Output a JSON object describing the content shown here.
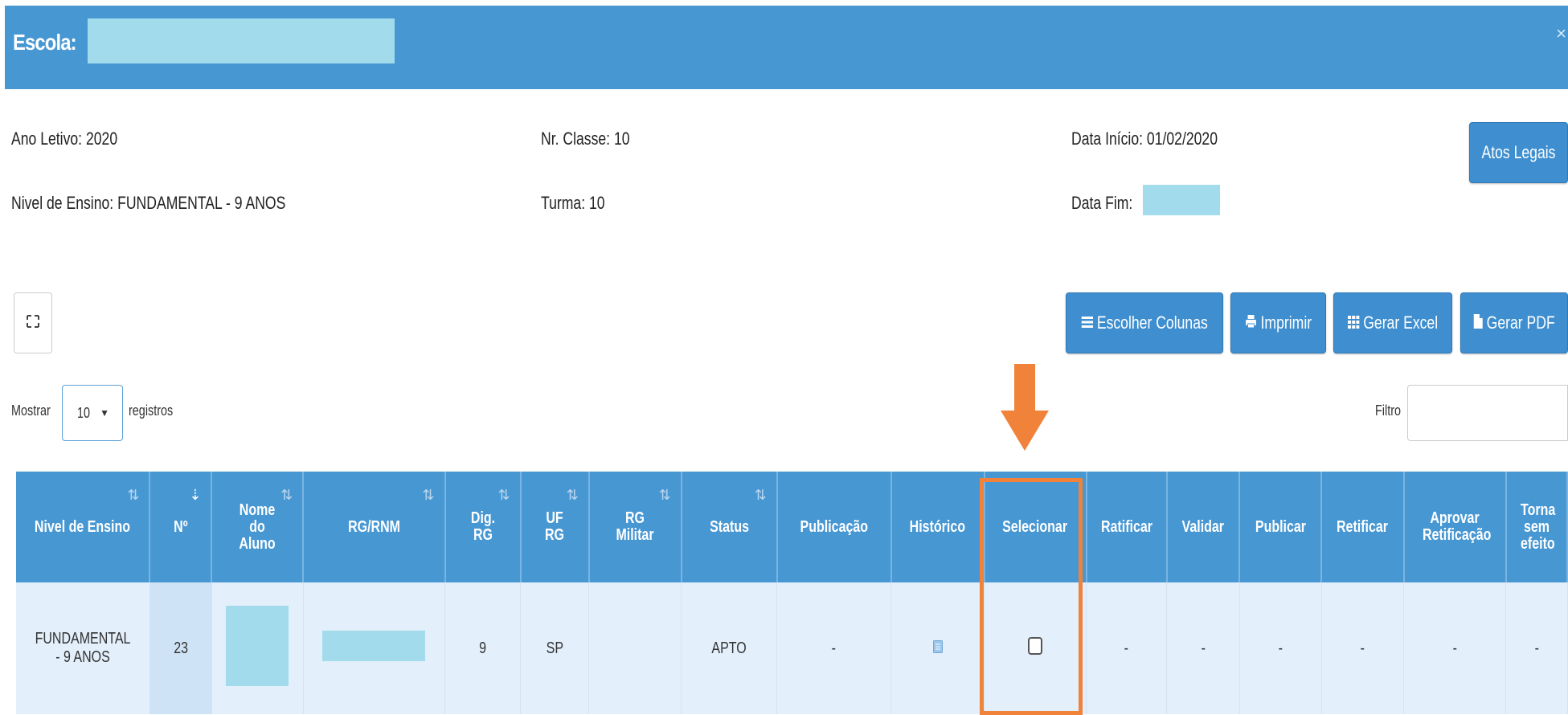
{
  "header": {
    "school_label": "Escola:",
    "close_symbol": "×"
  },
  "info": {
    "ano_letivo": "Ano Letivo: 2020",
    "nr_classe": "Nr. Classe: 10",
    "data_inicio": "Data Início: 01/02/2020",
    "nivel_ensino": "Nivel de Ensino: FUNDAMENTAL - 9 ANOS",
    "turma": "Turma: 10",
    "data_fim_label": "Data Fim:"
  },
  "buttons": {
    "atos_legais": "Atos Legais",
    "escolher_colunas": "Escolher Colunas",
    "imprimir": "Imprimir",
    "gerar_excel": "Gerar Excel",
    "gerar_pdf": "Gerar PDF"
  },
  "list_controls": {
    "mostrar": "Mostrar",
    "page_size": "10",
    "registros": "registros",
    "filtro": "Filtro"
  },
  "table": {
    "headers": [
      "Nivel de Ensino",
      "Nº",
      "Nome do Aluno",
      "RG/RNM",
      "Dig. RG",
      "UF RG",
      "RG Militar",
      "Status",
      "Publicação",
      "Histórico",
      "Selecionar",
      "Ratificar",
      "Validar",
      "Publicar",
      "Retificar",
      "Aprovar Retificação",
      "Torna sem efeito"
    ],
    "rows": [
      {
        "nivel": "FUNDAMENTAL - 9 ANOS",
        "numero": "23",
        "dig_rg": "9",
        "uf_rg": "SP",
        "rg_militar": "",
        "status": "APTO",
        "publicacao": "-",
        "ratificar": "-",
        "validar": "-",
        "publicar": "-",
        "retificar": "-",
        "aprovar_retificacao": "-",
        "torna_sem_efeito": "-"
      }
    ]
  },
  "colors": {
    "header_blue": "#4797d3",
    "button_blue": "#3f8fd0",
    "highlight_orange": "#f0823a",
    "redaction": "#a2dcec"
  }
}
